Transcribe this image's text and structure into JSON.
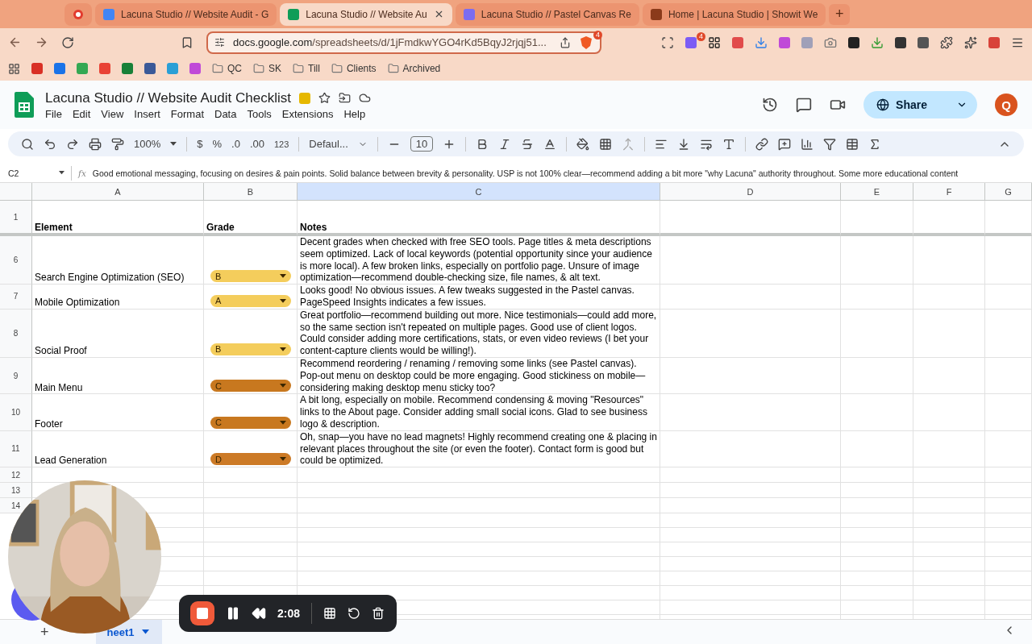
{
  "browser": {
    "tabs": [
      {
        "kind": "pinned",
        "selected": false
      },
      {
        "kind": "docs",
        "title": "Lacuna Studio // Website Audit - G",
        "selected": false
      },
      {
        "kind": "sheets",
        "title": "Lacuna Studio // Website Au",
        "selected": true
      },
      {
        "kind": "canvas",
        "title": "Lacuna Studio // Pastel Canvas Re",
        "selected": false
      },
      {
        "kind": "showit",
        "title": "Home | Lacuna Studio | Showit We",
        "selected": false
      }
    ],
    "new_tab": "+",
    "url_host": "docs.google.com",
    "url_path": "/spreadsheets/d/1jFmdkwYGO4rKd5BqyJ2rjqj51...",
    "shield_count": "4",
    "ext_badge": "4",
    "bookmarks": [
      "QC",
      "SK",
      "Till",
      "Clients",
      "Archived"
    ]
  },
  "doc": {
    "title": "Lacuna Studio // Website Audit Checklist",
    "menu": [
      "File",
      "Edit",
      "View",
      "Insert",
      "Format",
      "Data",
      "Tools",
      "Extensions",
      "Help"
    ],
    "share": "Share",
    "avatar": "Q"
  },
  "toolbar": {
    "zoom": "100%",
    "currency": "$",
    "percent": "%",
    "dec_less": ".0",
    "dec_more": ".00",
    "number_format": "123",
    "font": "Defaul...",
    "font_size": "10"
  },
  "formula_bar": {
    "cell": "C2",
    "fx": "fx",
    "content": "Good emotional messaging, focusing on desires & pain points. Solid balance between brevity & personality. USP is not 100% clear—recommend adding a bit more \"why Lacuna\" authority throughout. Some more educational content"
  },
  "grid": {
    "columns": [
      {
        "label": "A",
        "selected": false
      },
      {
        "label": "B",
        "selected": false
      },
      {
        "label": "C",
        "selected": true
      },
      {
        "label": "D",
        "selected": false
      },
      {
        "label": "E",
        "selected": false
      },
      {
        "label": "F",
        "selected": false
      },
      {
        "label": "G",
        "selected": false
      }
    ],
    "header_row": {
      "number": "1",
      "cells": [
        "Element",
        "Grade",
        "Notes"
      ]
    },
    "rows": [
      {
        "number": "6",
        "element": "Search Engine Optimization (SEO)",
        "grade": "B",
        "color": "#f4cd5c",
        "notes": "Decent grades when checked with free SEO tools. Page titles & meta descriptions seem optimized. Lack of local keywords (potential opportunity since your audience is more local). A few broken links, especially on portfolio page. Unsure of image optimization—recommend double-checking size, file names, & alt text."
      },
      {
        "number": "7",
        "element": "Mobile Optimization",
        "grade": "A",
        "color": "#f4cd5c",
        "notes": "Looks good! No obvious issues. A few tweaks suggested in the Pastel canvas. PageSpeed Insights indicates a few issues."
      },
      {
        "number": "8",
        "element": "Social Proof",
        "grade": "B",
        "color": "#f4cd5c",
        "notes": "Great portfolio—recommend building out more. Nice testimonials—could add more, so the same section isn't repeated on multiple pages. Good use of client logos. Could consider adding more certifications, stats, or even video reviews (I bet your content-capture clients would be willing!)."
      },
      {
        "number": "9",
        "element": "Main Menu",
        "grade": "C",
        "color": "#c8781f",
        "notes": "Recommend reordering / renaming / removing some links (see Pastel canvas). Pop-out menu on desktop could be more engaging. Good stickiness on mobile—considering making desktop menu sticky too?"
      },
      {
        "number": "10",
        "element": "Footer",
        "grade": "C",
        "color": "#c8781f",
        "notes": "A bit long, especially on mobile. Recommend condensing & moving \"Resources\" links to the About page. Consider adding small social icons. Glad to see business logo & description."
      },
      {
        "number": "11",
        "element": "Lead Generation",
        "grade": "D",
        "color": "#cc7a26",
        "notes": "Oh, snap—you have no lead magnets! Highly recommend creating one & placing in relevant places throughout the site (or even the footer). Contact form is good but could be optimized."
      }
    ],
    "empty_rows": [
      "12",
      "13",
      "14"
    ]
  },
  "sheet_tabs": {
    "add": "+",
    "tabs": [
      {
        "label": "heet1",
        "selected": true
      }
    ]
  },
  "recorder": {
    "time": "2:08"
  }
}
